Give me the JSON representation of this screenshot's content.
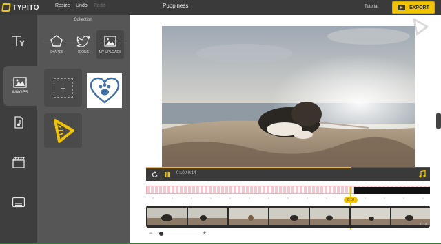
{
  "app": {
    "logo_text": "TYPITO",
    "project_title": "Puppiness"
  },
  "toolbar": {
    "resize": "Resize",
    "undo": "Undo",
    "redo": "Redo",
    "tutorial": "Tutorial",
    "export": "EXPORT"
  },
  "leftnav": {
    "items": [
      {
        "label": "",
        "icon": "text-icon"
      },
      {
        "label": "IMAGES",
        "icon": "image-icon",
        "active": true
      },
      {
        "label": "",
        "icon": "music-note-icon"
      },
      {
        "label": "",
        "icon": "clapperboard-icon"
      },
      {
        "label": "",
        "icon": "subtitles-icon"
      }
    ]
  },
  "collection": {
    "title": "Collection",
    "categories": [
      {
        "label": "SHAPES",
        "icon": "pentagon-icon"
      },
      {
        "label": "ICONS",
        "icon": "twitter-bird-icon"
      },
      {
        "label": "MY UPLOADS",
        "icon": "image-icon",
        "active": true
      }
    ],
    "uploads": [
      {
        "icon": "paw-heart-icon"
      },
      {
        "icon": "typito-logo-icon"
      }
    ]
  },
  "player": {
    "time": "0:10 / 0:14",
    "progress": 0.72
  },
  "timeline": {
    "marker": "0:10",
    "end_time": "0:14"
  },
  "colors": {
    "accent": "#f0c400",
    "topbar": "#3a3a3a",
    "nav": "#3e3e3e",
    "panel": "#565656",
    "heart": "#3f6fa5"
  }
}
